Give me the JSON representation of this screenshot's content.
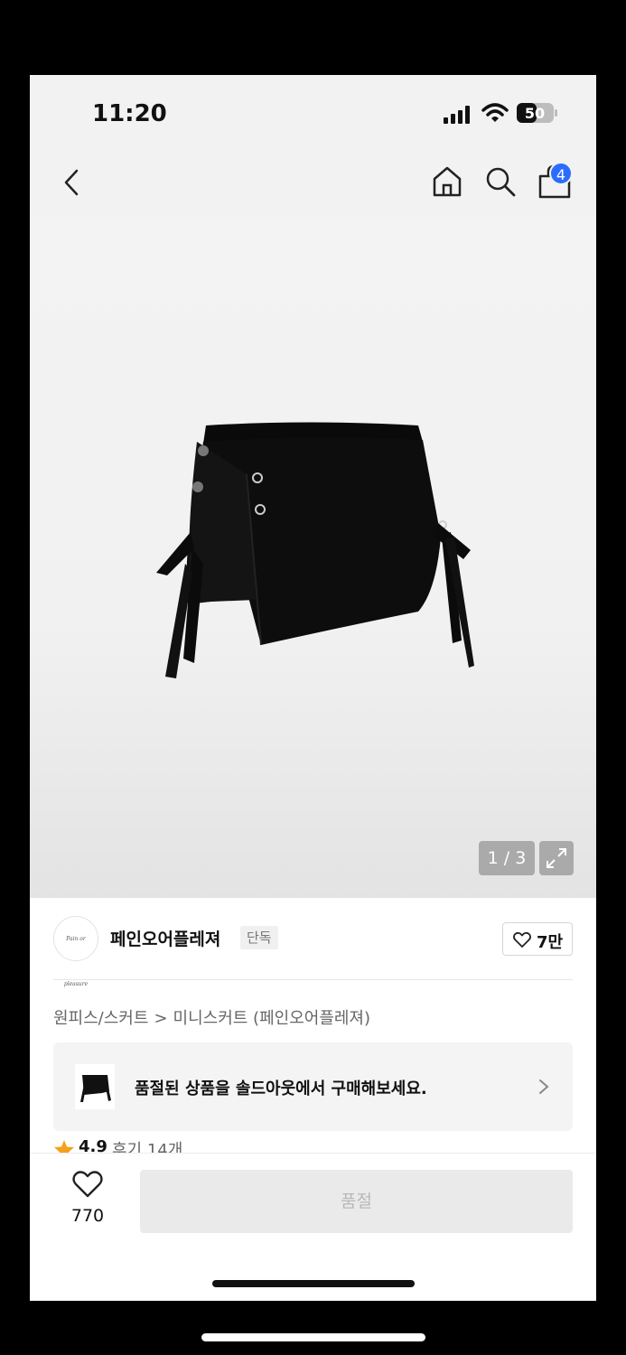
{
  "status_bar": {
    "time": "11:20",
    "battery": "50"
  },
  "nav": {
    "cart_count": "4"
  },
  "gallery": {
    "counter": "1 / 3"
  },
  "brand": {
    "logo_text": "Pain or pleasure",
    "name": "페인오어플레져",
    "exclusive_label": "단독",
    "likes": "7만"
  },
  "breadcrumb": {
    "category": "원피스/스커트",
    "separator": ">",
    "subcategory": "미니스커트 (페인오어플레져)"
  },
  "soldout_banner": {
    "text": "품절된 상품을 솔드아웃에서 구매해보세요."
  },
  "rating": {
    "score": "4.9",
    "reviews": "후기 14개"
  },
  "bottom_bar": {
    "wish_count": "770",
    "buy_label": "품절"
  },
  "colors": {
    "accent": "#2b6cff",
    "star": "#f4a21b",
    "disabled": "#eaeaea"
  }
}
